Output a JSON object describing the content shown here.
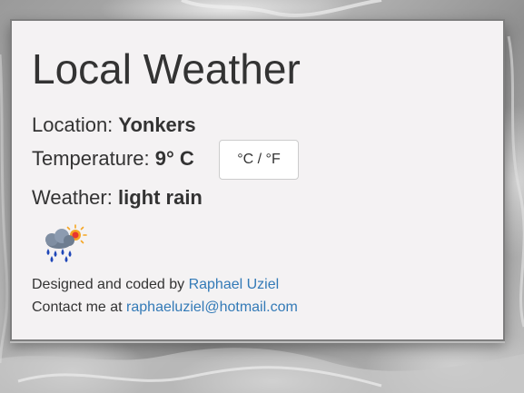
{
  "page": {
    "title": "Local Weather"
  },
  "location": {
    "label": "Location: ",
    "value": "Yonkers"
  },
  "temperature": {
    "label": "Temperature: ",
    "value": "9° C",
    "toggle_label": "°C / °F"
  },
  "weather": {
    "label": "Weather: ",
    "value": "light rain",
    "icon": "rain-sun-icon"
  },
  "footer": {
    "designed_prefix": "Designed and coded by ",
    "author_name": "Raphael Uziel",
    "contact_prefix": "Contact me at ",
    "email": "raphaeluziel@hotmail.com"
  },
  "colors": {
    "card_background": "#f4f2f3",
    "text": "#333333",
    "link": "#337ab7",
    "card_border": "#7e7e7e"
  }
}
